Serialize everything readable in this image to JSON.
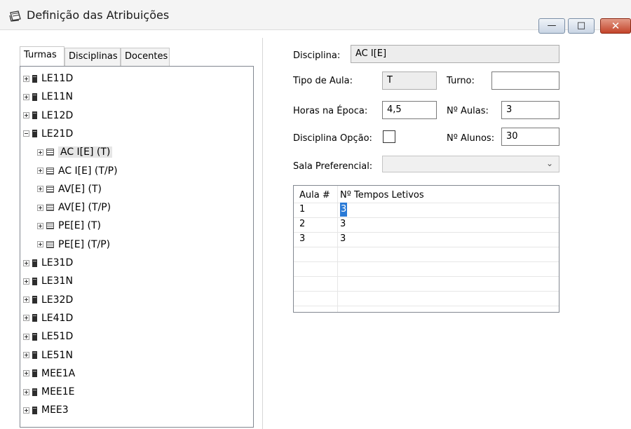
{
  "window": {
    "title": "Definição das Atribuições",
    "controls": {
      "minimize": "—",
      "maximize": "□",
      "close": "✕"
    }
  },
  "left": {
    "tabs": [
      "Turmas",
      "Disciplinas",
      "Docentes"
    ],
    "tree": [
      {
        "label": "LE11D",
        "level": 0,
        "expanded": false,
        "icon": "class-icon"
      },
      {
        "label": "LE11N",
        "level": 0,
        "expanded": false,
        "icon": "class-icon"
      },
      {
        "label": "LE12D",
        "level": 0,
        "expanded": false,
        "icon": "class-icon"
      },
      {
        "label": "LE21D",
        "level": 0,
        "expanded": true,
        "icon": "class-icon"
      },
      {
        "label": "AC I[E] (T)",
        "level": 1,
        "expanded": false,
        "icon": "subject-icon",
        "selected": true
      },
      {
        "label": "AC I[E] (T/P)",
        "level": 1,
        "expanded": false,
        "icon": "subject-icon"
      },
      {
        "label": "AV[E] (T)",
        "level": 1,
        "expanded": false,
        "icon": "subject-icon"
      },
      {
        "label": "AV[E] (T/P)",
        "level": 1,
        "expanded": false,
        "icon": "subject-icon"
      },
      {
        "label": "PE[E] (T)",
        "level": 1,
        "expanded": false,
        "icon": "subject-icon"
      },
      {
        "label": "PE[E] (T/P)",
        "level": 1,
        "expanded": false,
        "icon": "subject-icon"
      },
      {
        "label": "LE31D",
        "level": 0,
        "expanded": false,
        "icon": "class-icon"
      },
      {
        "label": "LE31N",
        "level": 0,
        "expanded": false,
        "icon": "class-icon"
      },
      {
        "label": "LE32D",
        "level": 0,
        "expanded": false,
        "icon": "class-icon"
      },
      {
        "label": "LE41D",
        "level": 0,
        "expanded": false,
        "icon": "class-icon"
      },
      {
        "label": "LE51D",
        "level": 0,
        "expanded": false,
        "icon": "class-icon"
      },
      {
        "label": "LE51N",
        "level": 0,
        "expanded": false,
        "icon": "class-icon"
      },
      {
        "label": "MEE1A",
        "level": 0,
        "expanded": false,
        "icon": "class-icon"
      },
      {
        "label": "MEE1E",
        "level": 0,
        "expanded": false,
        "icon": "class-icon"
      },
      {
        "label": "MEE3",
        "level": 0,
        "expanded": false,
        "icon": "class-icon"
      }
    ]
  },
  "form": {
    "disciplina_label": "Disciplina:",
    "disciplina_value": "AC I[E]",
    "tipo_label": "Tipo de Aula:",
    "tipo_value": "T",
    "turno_label": "Turno:",
    "turno_value": "",
    "horas_label": "Horas na Época:",
    "horas_value": "4,5",
    "naulas_label": "Nº Aulas:",
    "naulas_value": "3",
    "opcao_label": "Disciplina Opção:",
    "opcao_checked": false,
    "nalunos_label": "Nº Alunos:",
    "nalunos_value": "30",
    "sala_label": "Sala Preferencial:",
    "sala_value": ""
  },
  "grid": {
    "headers": [
      "Aula #",
      "Nº Tempos Letivos"
    ],
    "rows": [
      [
        "1",
        "3"
      ],
      [
        "2",
        "3"
      ],
      [
        "3",
        "3"
      ]
    ]
  }
}
